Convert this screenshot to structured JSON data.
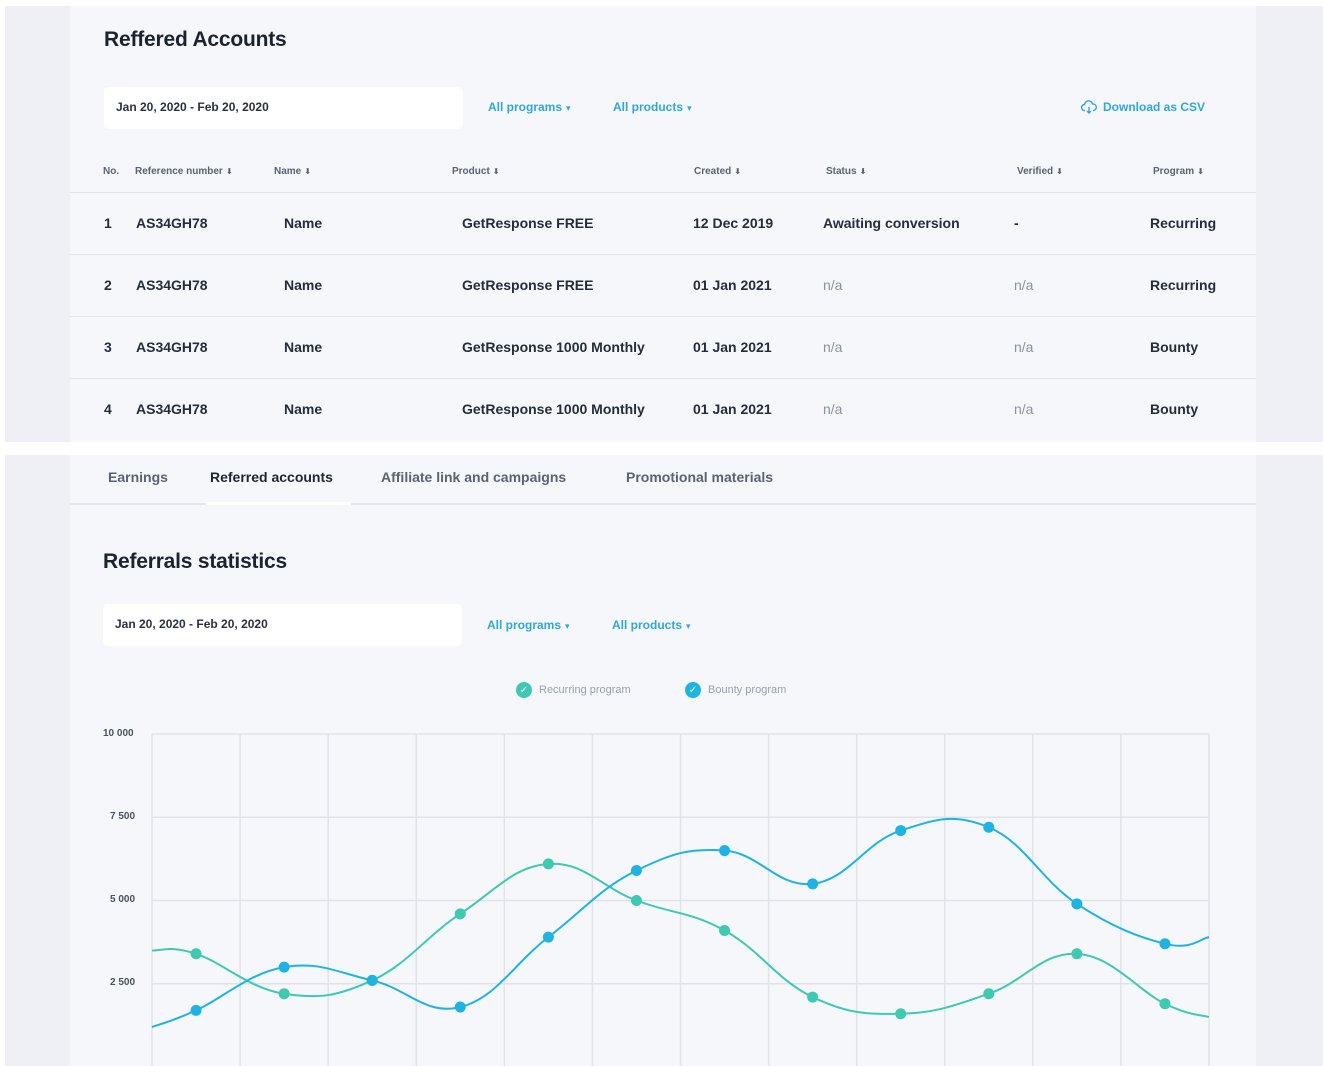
{
  "referred": {
    "title": "Reffered Accounts",
    "date_range": "Jan 20, 2020 - Feb 20, 2020",
    "programs_filter": "All programs",
    "products_filter": "All products",
    "download_label": "Download as CSV",
    "columns": [
      "No.",
      "Reference number",
      "Name",
      "Product",
      "Created",
      "Status",
      "Verified",
      "Program"
    ],
    "rows": [
      {
        "no": "1",
        "ref": "AS34GH78",
        "name": "Name",
        "product": "GetResponse FREE",
        "created": "12 Dec 2019",
        "status": "Awaiting conversion",
        "verified": "-",
        "program": "Recurring"
      },
      {
        "no": "2",
        "ref": "AS34GH78",
        "name": "Name",
        "product": "GetResponse FREE",
        "created": "01 Jan 2021",
        "status": "n/a",
        "verified": "n/a",
        "program": "Recurring"
      },
      {
        "no": "3",
        "ref": "AS34GH78",
        "name": "Name",
        "product": "GetResponse 1000 Monthly",
        "created": "01 Jan 2021",
        "status": "n/a",
        "verified": "n/a",
        "program": "Bounty"
      },
      {
        "no": "4",
        "ref": "AS34GH78",
        "name": "Name",
        "product": "GetResponse 1000 Monthly",
        "created": "01 Jan 2021",
        "status": "n/a",
        "verified": "n/a",
        "program": "Bounty"
      }
    ]
  },
  "tabs": [
    {
      "label": "Earnings",
      "active": false
    },
    {
      "label": "Referred accounts",
      "active": true
    },
    {
      "label": "Affiliate link and campaigns",
      "active": false
    },
    {
      "label": "Promotional materials",
      "active": false
    }
  ],
  "stats": {
    "title": "Referrals statistics",
    "date_range": "Jan 20, 2020 - Feb 20, 2020",
    "programs_filter": "All programs",
    "products_filter": "All products"
  },
  "colors": {
    "recurring": "#3ec9b0",
    "bounty": "#1fb3e3",
    "link": "#2fa8d8",
    "grid": "#e0e3ea"
  },
  "icons": {
    "download": "cloud-download-icon",
    "legend_check": "check-circle-icon",
    "sort": "sort-arrow-icon",
    "caret": "caret-down-icon"
  },
  "chart_data": {
    "type": "line",
    "smooth": true,
    "y_ticks": [
      "10 000",
      "7 500",
      "5 000",
      "2 500"
    ],
    "ylim": [
      0,
      10000
    ],
    "grid": true,
    "legend_position": "top-center",
    "series": [
      {
        "name": "Recurring program",
        "values": [
          3400,
          2200,
          2600,
          4600,
          6100,
          5000,
          4100,
          2100,
          1600,
          2200,
          3400,
          1900
        ]
      },
      {
        "name": "Bounty program",
        "values": [
          1700,
          3000,
          2600,
          1800,
          3900,
          5900,
          6500,
          5500,
          7100,
          7200,
          4900,
          3700
        ]
      }
    ]
  }
}
